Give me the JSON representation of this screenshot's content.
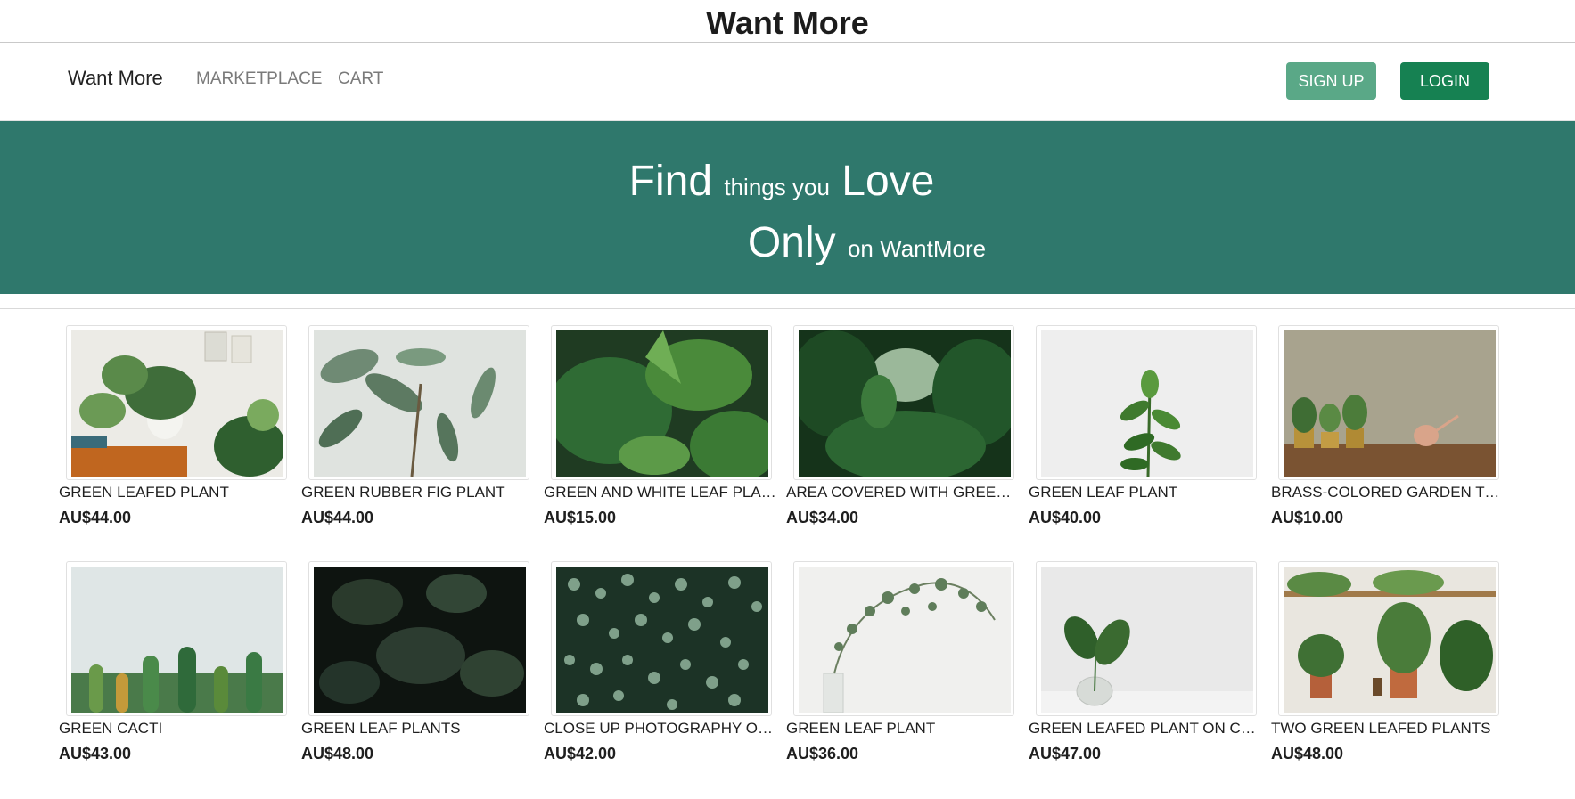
{
  "site": {
    "title": "Want More"
  },
  "navbar": {
    "brand": "Want More",
    "links": [
      "MARKETPLACE",
      "CART"
    ],
    "signup_label": "SIGN UP",
    "login_label": "LOGIN"
  },
  "hero": {
    "line1_a": "Find",
    "line1_b": "things you",
    "line1_c": "Love",
    "line2_a": "Only",
    "line2_b": "on WantMore",
    "background": "#2f786c"
  },
  "colors": {
    "signup": "#5aa887",
    "login": "#168152"
  },
  "products": [
    {
      "name": "GREEN LEAFED PLANT",
      "price": "AU$44.00",
      "image": "potted-plants-shelf-photo"
    },
    {
      "name": "GREEN RUBBER FIG PLANT",
      "price": "AU$44.00",
      "image": "rubber-fig-photo"
    },
    {
      "name": "GREEN AND WHITE LEAF PLANT",
      "price": "AU$15.00",
      "image": "monstera-fern-photo"
    },
    {
      "name": "AREA COVERED WITH GREEN PLANTS",
      "price": "AU$34.00",
      "image": "jungle-photo"
    },
    {
      "name": "GREEN LEAF PLANT",
      "price": "AU$40.00",
      "image": "single-plant-white-photo"
    },
    {
      "name": "BRASS-COLORED GARDEN TOOLS",
      "price": "AU$10.00",
      "image": "brass-pots-table-photo"
    },
    {
      "name": "GREEN CACTI",
      "price": "AU$43.00",
      "image": "cacti-photo"
    },
    {
      "name": "GREEN LEAF PLANTS",
      "price": "AU$48.00",
      "image": "dark-monstera-photo"
    },
    {
      "name": "CLOSE UP PHOTOGRAPHY OF GREEN LEAVES",
      "price": "AU$42.00",
      "image": "small-leaves-closeup-photo"
    },
    {
      "name": "GREEN LEAF PLANT",
      "price": "AU$36.00",
      "image": "eucalyptus-vase-photo"
    },
    {
      "name": "GREEN LEAFED PLANT ON CLEAR GLASS VASE",
      "price": "AU$47.00",
      "image": "glass-vase-plant-photo"
    },
    {
      "name": "TWO GREEN LEAFED PLANTS",
      "price": "AU$48.00",
      "image": "terracotta-pots-photo"
    }
  ]
}
